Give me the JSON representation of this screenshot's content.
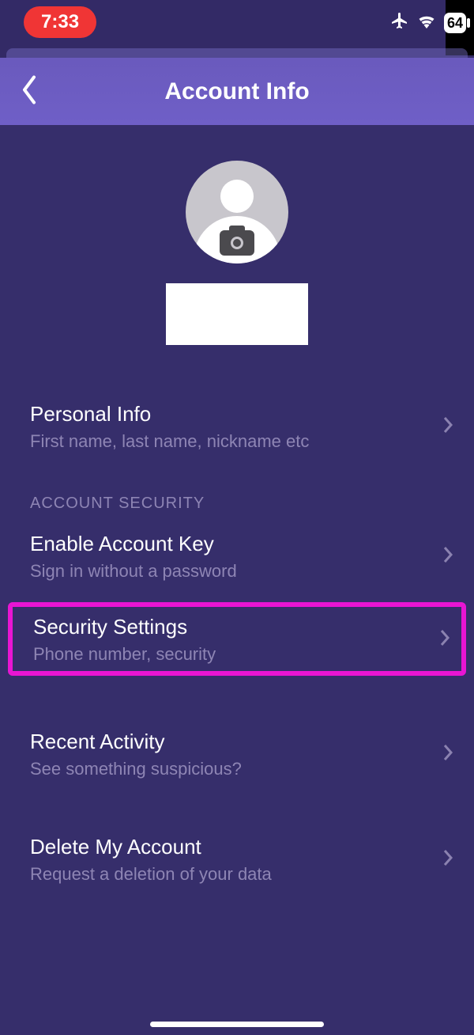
{
  "status": {
    "time": "7:33",
    "battery": "64"
  },
  "nav": {
    "title": "Account Info"
  },
  "sections": {
    "personal": {
      "title": "Personal Info",
      "sub": "First name, last name, nickname etc"
    },
    "security_header": "ACCOUNT SECURITY",
    "account_key": {
      "title": "Enable Account Key",
      "sub": "Sign in without a password"
    },
    "security_settings": {
      "title": "Security Settings",
      "sub": "Phone number, security"
    },
    "recent": {
      "title": "Recent Activity",
      "sub": "See something suspicious?"
    },
    "delete": {
      "title": "Delete My Account",
      "sub": "Request a deletion of your data"
    }
  }
}
